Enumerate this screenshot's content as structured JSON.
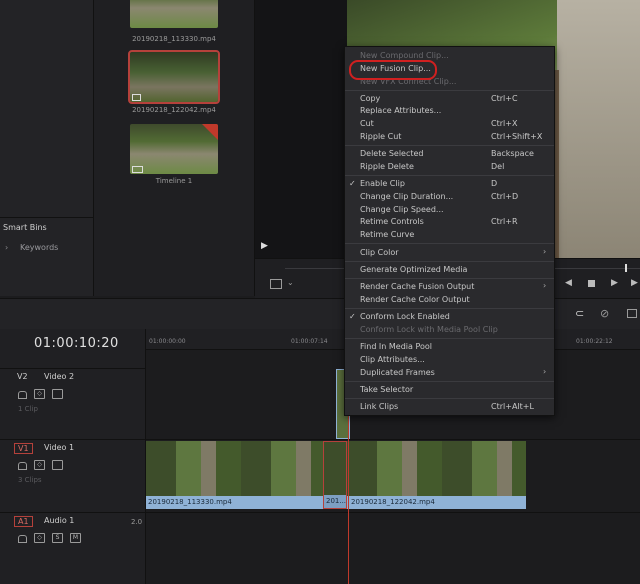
{
  "media_pool": {
    "thumbs": [
      {
        "label": "20190218_113330.mp4"
      },
      {
        "label": "20190218_122042.mp4"
      },
      {
        "label": "Timeline 1"
      }
    ],
    "smart_bins": "Smart Bins",
    "keywords": "Keywords"
  },
  "timecode": "01:00:10:20",
  "ruler": [
    "01:00:00:00",
    "01:00:07:14",
    "01:00:22:12"
  ],
  "tracks": [
    {
      "id": "V2",
      "name": "Video 2",
      "count": "1 Clip"
    },
    {
      "id": "V1",
      "name": "Video 1",
      "count": "3 Clips"
    },
    {
      "id": "A1",
      "name": "Audio 1",
      "level": "2.0"
    }
  ],
  "clips": {
    "first": "20190218_113330.mp4",
    "mid": "201...",
    "last": "20190218_122042.mp4"
  },
  "menu": {
    "items": [
      {
        "label": "New Compound Clip...",
        "shortcut": "",
        "disabled": true
      },
      {
        "label": "New Fusion Clip...",
        "shortcut": "",
        "disabled": false
      },
      {
        "label": "New VFX Connect Clip...",
        "shortcut": "",
        "disabled": true
      },
      {
        "label": "Copy",
        "shortcut": "Ctrl+C"
      },
      {
        "label": "Replace Attributes...",
        "shortcut": ""
      },
      {
        "label": "Cut",
        "shortcut": "Ctrl+X"
      },
      {
        "label": "Ripple Cut",
        "shortcut": "Ctrl+Shift+X"
      },
      {
        "label": "Delete Selected",
        "shortcut": "Backspace"
      },
      {
        "label": "Ripple Delete",
        "shortcut": "Del"
      },
      {
        "label": "Enable Clip",
        "shortcut": "D"
      },
      {
        "label": "Change Clip Duration...",
        "shortcut": "Ctrl+D"
      },
      {
        "label": "Change Clip Speed...",
        "shortcut": ""
      },
      {
        "label": "Retime Controls",
        "shortcut": "Ctrl+R"
      },
      {
        "label": "Retime Curve",
        "shortcut": ""
      },
      {
        "label": "Clip Color",
        "shortcut": ""
      },
      {
        "label": "Generate Optimized Media",
        "shortcut": ""
      },
      {
        "label": "Render Cache Fusion Output",
        "shortcut": ""
      },
      {
        "label": "Render Cache Color Output",
        "shortcut": ""
      },
      {
        "label": "Conform Lock Enabled",
        "shortcut": ""
      },
      {
        "label": "Conform Lock with Media Pool Clip",
        "shortcut": "",
        "disabled": true
      },
      {
        "label": "Find In Media Pool",
        "shortcut": ""
      },
      {
        "label": "Clip Attributes...",
        "shortcut": ""
      },
      {
        "label": "Duplicated Frames",
        "shortcut": ""
      },
      {
        "label": "Take Selector",
        "shortcut": ""
      },
      {
        "label": "Link Clips",
        "shortcut": "Ctrl+Alt+L"
      }
    ]
  },
  "colors": {
    "accent_red": "#b5413b",
    "highlight_ring": "#d02020",
    "clip_bar": "#8fb2d6",
    "playhead": "#c0392b"
  }
}
